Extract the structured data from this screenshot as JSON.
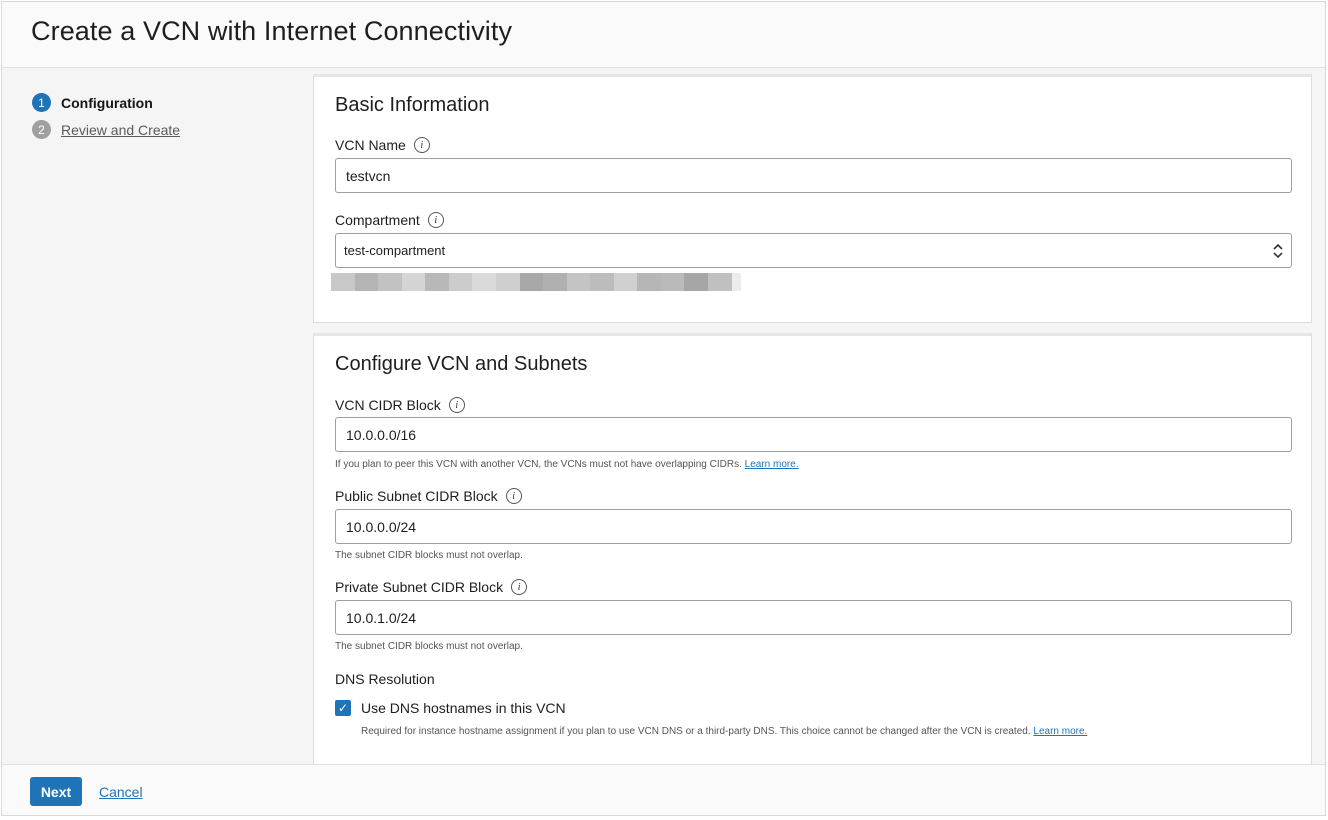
{
  "header": {
    "title": "Create a VCN with Internet Connectivity"
  },
  "steps": [
    {
      "number": "1",
      "label": "Configuration",
      "state": "active"
    },
    {
      "number": "2",
      "label": "Review and Create",
      "state": "inactive"
    }
  ],
  "basic_info": {
    "title": "Basic Information",
    "vcn_name": {
      "label": "VCN Name",
      "value": "testvcn"
    },
    "compartment": {
      "label": "Compartment",
      "value": "test-compartment"
    }
  },
  "configure": {
    "title": "Configure VCN and Subnets",
    "vcn_cidr": {
      "label": "VCN CIDR Block",
      "value": "10.0.0.0/16",
      "help": "If you plan to peer this VCN with another VCN, the VCNs must not have overlapping CIDRs.",
      "help_link": "Learn more."
    },
    "public_cidr": {
      "label": "Public Subnet CIDR Block",
      "value": "10.0.0.0/24",
      "help": "The subnet CIDR blocks must not overlap."
    },
    "private_cidr": {
      "label": "Private Subnet CIDR Block",
      "value": "10.0.1.0/24",
      "help": "The subnet CIDR blocks must not overlap."
    },
    "dns": {
      "label": "DNS Resolution",
      "checkbox_label": "Use DNS hostnames in this VCN",
      "checked": true,
      "help": "Required for instance hostname assignment if you plan to use VCN DNS or a third-party DNS. This choice cannot be changed after the VCN is created.",
      "help_link": "Learn more."
    }
  },
  "footer": {
    "next_label": "Next",
    "cancel_label": "Cancel"
  },
  "colors": {
    "accent": "#1f73b7",
    "step_inactive": "#a0a0a0"
  },
  "icons": {
    "info": "info-icon",
    "checkbox": "check-icon",
    "select": "up-down-chevron-icon"
  }
}
